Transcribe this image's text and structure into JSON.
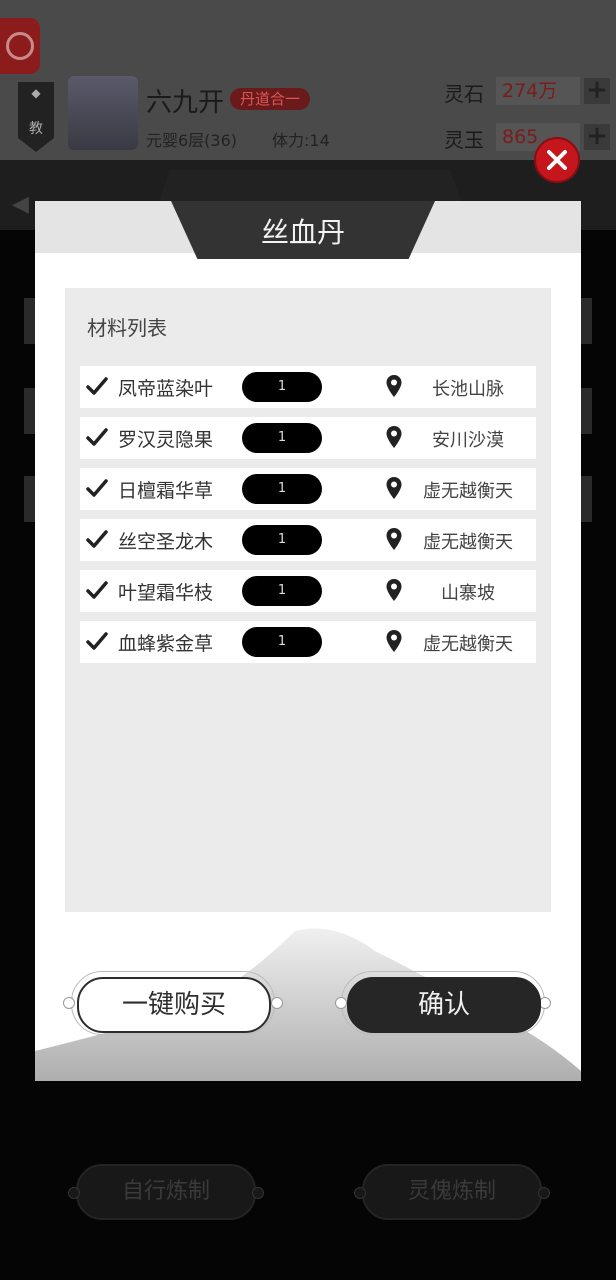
{
  "player": {
    "name": "六九开",
    "tag": "丹道合一",
    "level": "元婴6层(36)",
    "stamina": "体力:14",
    "sect_char": "教"
  },
  "currency": {
    "spirit_stone_label": "灵石",
    "spirit_stone_value": "274万",
    "spirit_jade_label": "灵玉",
    "spirit_jade_value": "865",
    "plus": "+"
  },
  "modal": {
    "title": "丝血丹",
    "materials_heading": "材料列表",
    "materials": [
      {
        "name": "凤帝蓝染叶",
        "qty": "1",
        "location": "长池山脉"
      },
      {
        "name": "罗汉灵隐果",
        "qty": "1",
        "location": "安川沙漠"
      },
      {
        "name": "日檀霜华草",
        "qty": "1",
        "location": "虚无越衡天"
      },
      {
        "name": "丝空圣龙木",
        "qty": "1",
        "location": "虚无越衡天"
      },
      {
        "name": "叶望霜华枝",
        "qty": "1",
        "location": "山寨坡"
      },
      {
        "name": "血蜂紫金草",
        "qty": "1",
        "location": "虚无越衡天"
      }
    ],
    "buy_all_label": "一键购买",
    "confirm_label": "确认"
  },
  "background_buttons": {
    "self_refine": "自行炼制",
    "puppet_refine": "灵傀炼制"
  },
  "icons": {
    "check": "check-icon",
    "location": "location-pin-icon",
    "close": "close-icon"
  },
  "colors": {
    "accent_red": "#c4161c",
    "dark": "#262626",
    "panel_gray": "#ebebeb"
  }
}
